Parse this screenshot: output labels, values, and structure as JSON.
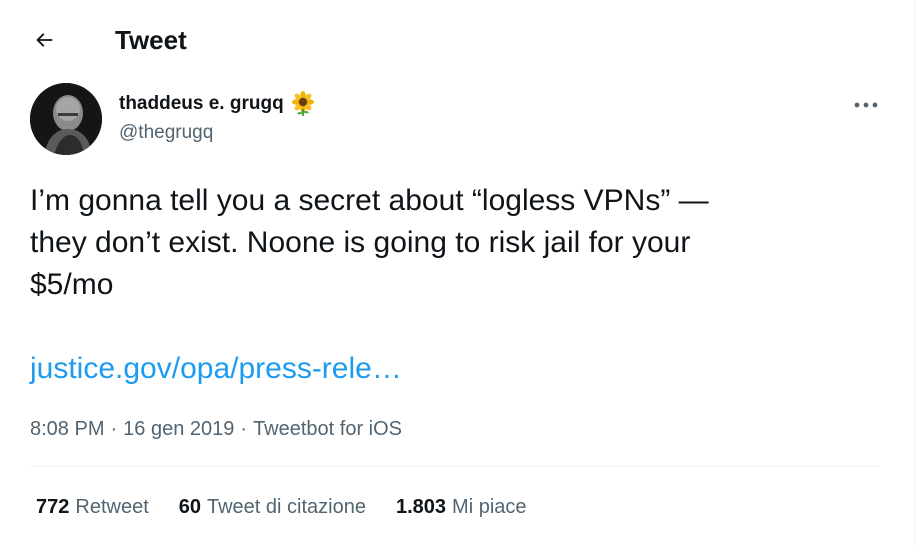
{
  "header": {
    "title": "Tweet",
    "back_icon": "arrow-left-icon"
  },
  "author": {
    "name": "thaddeus e. grugq",
    "emoji": "sunflower",
    "handle": "@thegrugq"
  },
  "tweet": {
    "text": "I’m gonna tell you a secret about “logless VPNs” —\nthey don’t exist. Noone is going to risk jail for your\n$5/mo",
    "link": "justice.gov/opa/press-rele…",
    "time": "8:08 PM",
    "date": "16 gen 2019",
    "source": "Tweetbot for iOS",
    "separator": "·"
  },
  "stats": [
    {
      "count": "772",
      "label": "Retweet"
    },
    {
      "count": "60",
      "label": "Tweet di citazione"
    },
    {
      "count": "1.803",
      "label": "Mi piace"
    }
  ],
  "colors": {
    "text": "#0f1419",
    "secondary": "#536471",
    "link": "#1d9bf0",
    "divider": "#eff3f4"
  }
}
